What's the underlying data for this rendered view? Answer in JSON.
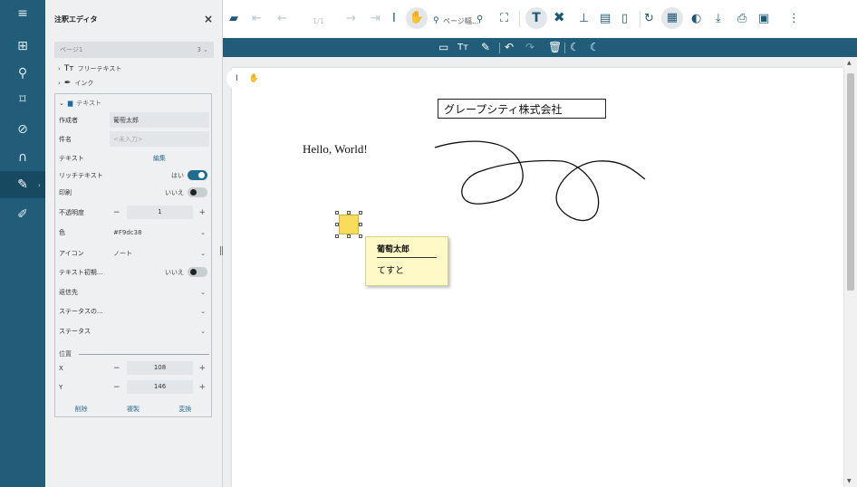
{
  "rail": {
    "icons": [
      "menu-icon",
      "thumbnails-icon",
      "search-icon",
      "bookmark-icon",
      "attachment-icon",
      "layers-icon",
      "annotation-editor-icon",
      "form-editor-icon"
    ],
    "glyphs": [
      "≡",
      "⊞",
      "⚲",
      "⌑",
      "⊘",
      "∩",
      "✎",
      "✐"
    ]
  },
  "panel": {
    "title": "注釈エディタ",
    "close_glyph": "×",
    "page_select": "ページ1",
    "page_count": "3",
    "tree": {
      "freetext": "フリーテキスト",
      "ink": "インク",
      "text": "テキスト"
    },
    "props": {
      "author_label": "作成者",
      "author_value": "葡萄太郎",
      "subject_label": "件名",
      "subject_placeholder": "<未入力>",
      "text_label": "テキスト",
      "text_edit": "編集",
      "rich_label": "リッチテキスト",
      "rich_value": "はい",
      "print_label": "印刷",
      "print_value": "いいえ",
      "opacity_label": "不透明度",
      "opacity_value": "1",
      "color_label": "色",
      "color_value": "#F9dc38",
      "icon_label": "アイコン",
      "icon_value": "ノート",
      "textinit_label": "テキスト初期...",
      "textinit_value": "いいえ",
      "reply_label": "返信先",
      "status_model_label": "ステータスの...",
      "status_label": "ステータス",
      "position_label": "位置",
      "x_label": "X",
      "x_value": "108",
      "y_label": "Y",
      "y_value": "146",
      "minus": "−",
      "plus": "+",
      "delete": "削除",
      "duplicate": "複製",
      "convert": "変換"
    }
  },
  "toolbar": {
    "page_indicator": "1/1",
    "zoom_placeholder": "ページ幅..."
  },
  "document": {
    "company": "グレープシティ株式会社",
    "hello": "Hello, World!",
    "popup_author": "葡萄太郎",
    "popup_text": "てすと"
  },
  "colors": {
    "accent": "#215d78",
    "sticky": "#f9dc5c",
    "popup": "#fff9c8"
  }
}
